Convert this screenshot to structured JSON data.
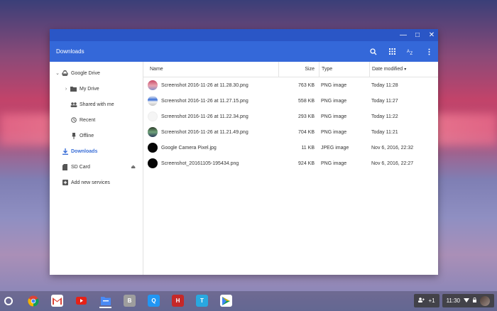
{
  "window": {
    "title": "Downloads",
    "controls": {
      "minimize": "—",
      "maximize": "□",
      "close": "✕"
    },
    "appbar_icons": [
      "search-icon",
      "grid-view-icon",
      "sort-az-icon",
      "more-vert-icon"
    ]
  },
  "sidebar": {
    "items": [
      {
        "label": "Google Drive",
        "icon": "drive-icon",
        "chevron": "⌄"
      },
      {
        "label": "My Drive",
        "icon": "folder-icon",
        "chevron": "›"
      },
      {
        "label": "Shared with me",
        "icon": "people-icon"
      },
      {
        "label": "Recent",
        "icon": "clock-icon"
      },
      {
        "label": "Offline",
        "icon": "pin-icon"
      },
      {
        "label": "Downloads",
        "icon": "download-icon"
      },
      {
        "label": "SD Card",
        "icon": "sd-card-icon",
        "eject": "⏏"
      },
      {
        "label": "Add new services",
        "icon": "add-icon"
      }
    ]
  },
  "table": {
    "headers": {
      "name": "Name",
      "size": "Size",
      "type": "Type",
      "date": "Date modified"
    },
    "rows": [
      {
        "name": "Screenshot 2016-11-26 at 11.28.30.png",
        "size": "763 KB",
        "type": "PNG image",
        "date": "Today 11:28"
      },
      {
        "name": "Screenshot 2016-11-26 at 11.27.15.png",
        "size": "558 KB",
        "type": "PNG image",
        "date": "Today 11:27"
      },
      {
        "name": "Screenshot 2016-11-26 at 11.22.34.png",
        "size": "293 KB",
        "type": "PNG image",
        "date": "Today 11:22"
      },
      {
        "name": "Screenshot 2016-11-26 at 11.21.49.png",
        "size": "704 KB",
        "type": "PNG image",
        "date": "Today 11:21"
      },
      {
        "name": "Google Camera Pixel.jpg",
        "size": "11 KB",
        "type": "JPEG image",
        "date": "Nov 6, 2016, 22:32"
      },
      {
        "name": "Screenshot_20161105-195434.png",
        "size": "924 KB",
        "type": "PNG image",
        "date": "Nov 6, 2016, 22:27"
      }
    ]
  },
  "taskbar": {
    "apps": [
      {
        "name": "chrome-icon",
        "label": ""
      },
      {
        "name": "gmail-icon",
        "label": ""
      },
      {
        "name": "youtube-icon",
        "label": ""
      },
      {
        "name": "files-icon",
        "label": ""
      },
      {
        "name": "app-b-icon",
        "label": "B"
      },
      {
        "name": "app-q-icon",
        "label": "Q"
      },
      {
        "name": "app-h-icon",
        "label": "H"
      },
      {
        "name": "app-t-icon",
        "label": "T"
      },
      {
        "name": "play-store-icon",
        "label": ""
      }
    ],
    "notification": "+1",
    "time": "11:30"
  }
}
